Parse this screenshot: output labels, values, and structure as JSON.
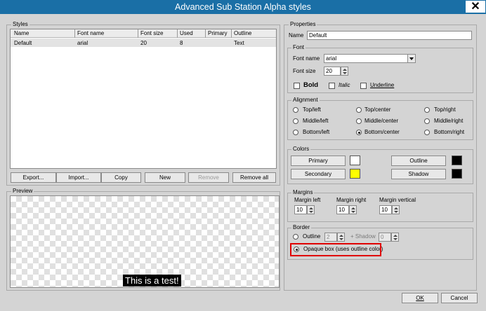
{
  "window": {
    "title": "Advanced Sub Station Alpha styles",
    "close_glyph": "✕"
  },
  "styles": {
    "group_label": "Styles",
    "columns": [
      "Name",
      "Font name",
      "Font size",
      "Used",
      "Primary",
      "Outline"
    ],
    "rows": [
      {
        "name": "Default",
        "font_name": "arial",
        "font_size": "20",
        "used": "8",
        "primary": "",
        "outline": "Text"
      }
    ],
    "buttons": {
      "export": "Export...",
      "import": "Import...",
      "copy": "Copy",
      "new": "New",
      "remove": "Remove",
      "remove_all": "Remove all"
    }
  },
  "preview": {
    "group_label": "Preview",
    "sample_text": "This is a test!"
  },
  "properties": {
    "group_label": "Properties",
    "name_label": "Name",
    "name_value": "Default",
    "font": {
      "group_label": "Font",
      "font_name_label": "Font name",
      "font_name_value": "arial",
      "font_size_label": "Font size",
      "font_size_value": "20",
      "bold_label": "Bold",
      "italic_label": "Italic",
      "underline_label": "Underline"
    },
    "alignment": {
      "group_label": "Alignment",
      "options": [
        "Top/left",
        "Top/center",
        "Top/right",
        "Middle/left",
        "Middle/center",
        "Middle/right",
        "Bottom/left",
        "Bottom/center",
        "Bottom/right"
      ],
      "selected": "Bottom/center"
    },
    "colors": {
      "group_label": "Colors",
      "primary_label": "Primary",
      "primary_color": "#ffffff",
      "secondary_label": "Secondary",
      "secondary_color": "#ffff00",
      "outline_label": "Outline",
      "outline_color": "#000000",
      "shadow_label": "Shadow",
      "shadow_color": "#000000"
    },
    "margins": {
      "group_label": "Margins",
      "left_label": "Margin left",
      "left_value": "10",
      "right_label": "Margin right",
      "right_value": "10",
      "vertical_label": "Margin vertical",
      "vertical_value": "10"
    },
    "border": {
      "group_label": "Border",
      "outline_label": "Outline",
      "outline_value": "2",
      "shadow_label": "+ Shadow",
      "shadow_value": "0",
      "opaque_label": "Opaque box (uses outline color)",
      "selected": "Opaque box (uses outline color)"
    }
  },
  "footer": {
    "ok_label": "OK",
    "cancel_label": "Cancel"
  }
}
